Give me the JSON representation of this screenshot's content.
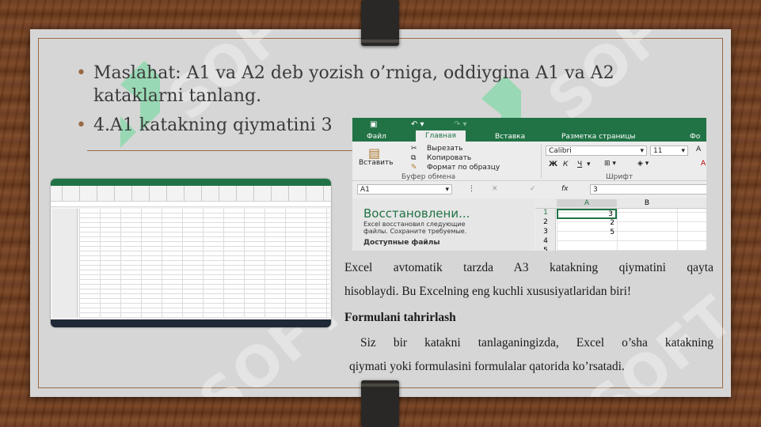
{
  "bullets": [
    "Maslahat: A1 va A2 deb yozish o’rniga, oddiygina A1 va A2 kataklarni tanlang.",
    "4.A1 katakning qiymatini 3"
  ],
  "excel": {
    "tabs": [
      "Файл",
      "Главная",
      "Вставка",
      "Разметка страницы",
      "Фо"
    ],
    "paste": "Вставить",
    "cut": "Вырезать",
    "copy": "Копировать",
    "format_painter": "Формат по образцу",
    "clipboard_group": "Буфер обмена",
    "font_name": "Calibri",
    "font_size": "11",
    "font_group": "Шрифт",
    "bold": "Ж",
    "italic": "К",
    "underline": "Ч",
    "name_box": "A1",
    "fx": "fx",
    "formula_value": "3",
    "recovery_title": "Восстановлени...",
    "recovery_line1": "Excel восстановил следующие",
    "recovery_line2": "файлы. Сохраните требуемые.",
    "available_files": "Доступные файлы",
    "columns": [
      "A",
      "B"
    ],
    "rows": [
      "1",
      "2",
      "3",
      "4",
      "5"
    ],
    "values": [
      "3",
      "2",
      "5"
    ]
  },
  "text": {
    "para1_line1": "Excel avtomatik tarzda A3 katakning qiymatini qayta",
    "para1_line2": "hisoblaydi. Bu Excelning eng kuchli xususiyatlaridan biri!",
    "heading": "Formulani tahrirlash",
    "para2_line1": "Siz bir katakni tanlaganingizda,  Excel o’sha katakning",
    "para2_line2": "qiymati yoki formulasini formulalar qatorida ko’rsatadi."
  },
  "watermark": "SOFT",
  "colors": {
    "excel_green": "#217346",
    "accent_brown": "#9a6a45",
    "slide_bg": "#d6d6d6"
  }
}
